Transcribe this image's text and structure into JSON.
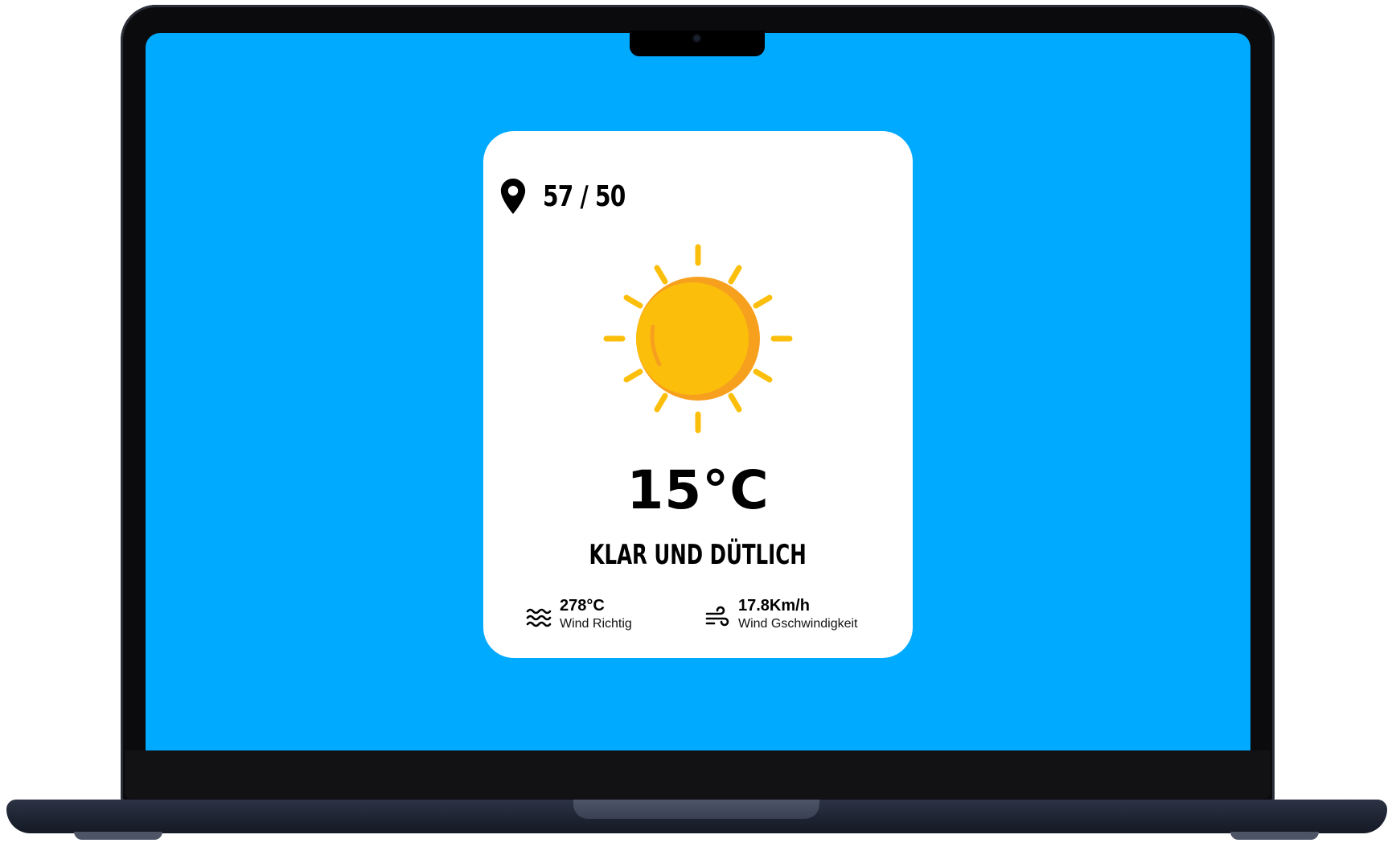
{
  "colors": {
    "screen_background": "#00aaff",
    "card_background": "#ffffff",
    "sun": "#fbbf0b",
    "sun_shade": "#f7a01e",
    "text": "#000000"
  },
  "weather": {
    "location_icon": "location-pin-icon",
    "coordinates": "57 / 50",
    "condition_icon": "sun-icon",
    "temperature": "15°C",
    "condition": "KLAR UND DÜTLICH",
    "stats": [
      {
        "icon": "waves-icon",
        "value": "278°C",
        "label": "Wind Richtig"
      },
      {
        "icon": "wind-icon",
        "value": "17.8Km/h",
        "label": "Wind Gschwindigkeit"
      }
    ]
  }
}
